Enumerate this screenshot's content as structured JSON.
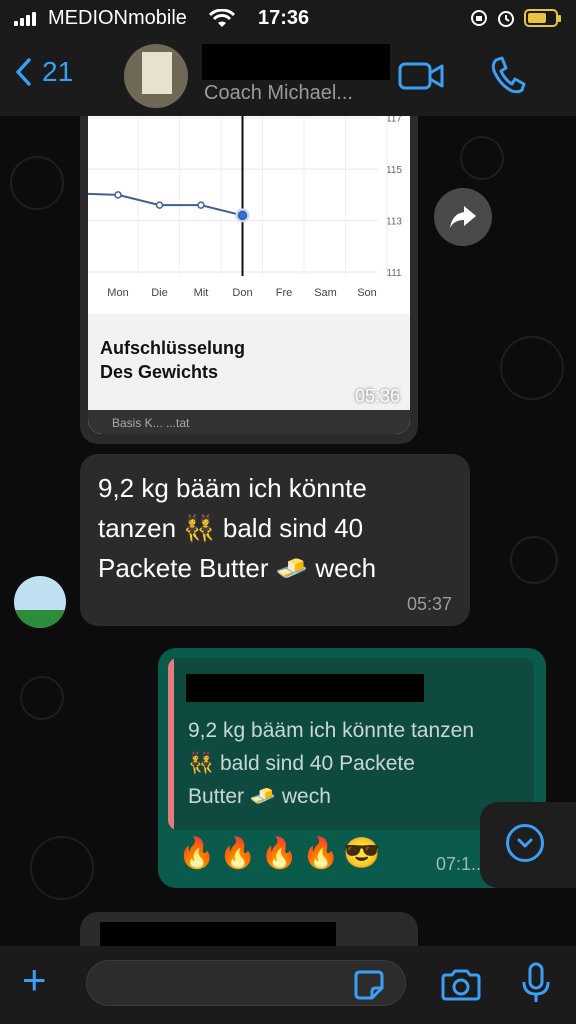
{
  "status_bar": {
    "carrier": "MEDIONmobile",
    "time": "17:36"
  },
  "header": {
    "back_count": "21",
    "contact_subtitle": "Coach Michael..."
  },
  "chart_message": {
    "chart_data": {
      "type": "line",
      "categories": [
        "Mon",
        "Die",
        "Mit",
        "Don",
        "Fre",
        "Sam",
        "Son"
      ],
      "values": [
        114.0,
        113.6,
        113.6,
        113.2,
        null,
        null,
        null
      ],
      "ytick_labels": [
        "117",
        "115",
        "113",
        "111"
      ],
      "ylim": [
        111,
        118
      ],
      "grid": true
    },
    "title_line1": "Aufschlüsselung",
    "title_line2": "Des Gewichts",
    "time": "05:36",
    "cut_off_text": "Basis K... ...tat"
  },
  "incoming_message": {
    "line1": "9,2 kg  bääm ich könnte",
    "line2": "tanzen 👯 bald sind 40",
    "line3": "Packete Butter 🧈 wech",
    "time": "05:37"
  },
  "outgoing_message": {
    "quoted_text_line1": "9,2 kg  bääm ich könnte tanzen",
    "quoted_text_line2": "👯 bald sind 40 Packete",
    "quoted_text_line3": "Butter 🧈 wech",
    "reply_text": "🔥🔥🔥🔥😎",
    "time": "07:1..."
  },
  "colors": {
    "accent": "#3a9ff5",
    "outgoing_bubble": "#0a5b4c",
    "incoming_bubble": "#2b2b2b",
    "quote_bar": "#e77a80"
  }
}
